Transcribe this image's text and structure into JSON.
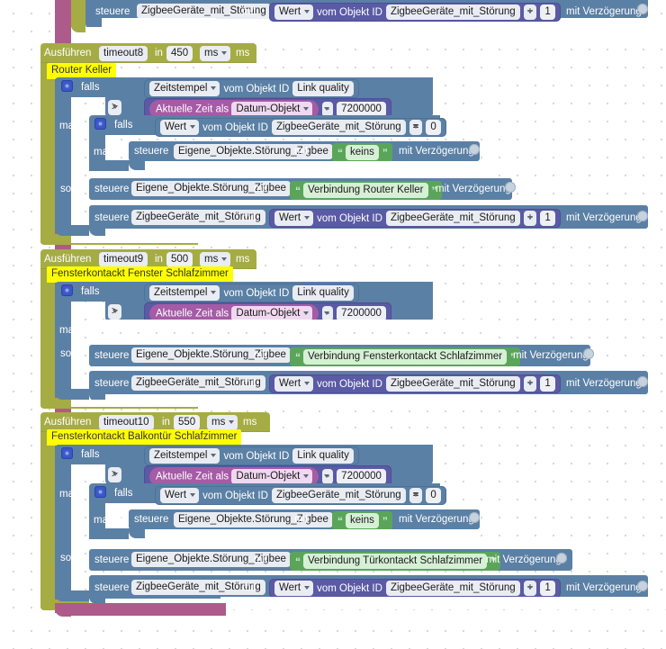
{
  "workspace": {
    "editor": "blockly",
    "grid_color": "#d0d0d0",
    "colors": {
      "wrapper": "#ad5b8a",
      "timeout": "#a5ac43",
      "control": "#5b80a5",
      "math": "#5a5aa5",
      "date": "#a55ba5",
      "text": "#5ba55b",
      "comment": "#ffff00",
      "gear": "#3a56c8"
    }
  },
  "labels": {
    "ausfuehren": "Ausführen",
    "in": "in",
    "ms_unit": "ms",
    "ms_suffix": "ms",
    "falls": "falls",
    "mache": "mache",
    "sonst": "sonst",
    "steuere": "steuere",
    "mit": "mit",
    "vom_objekt_id": "vom Objekt ID",
    "mit_verzoegerung": "mit Verzögerung",
    "wert": "Wert",
    "zeitstempel": "Zeitstempel",
    "aktuelle_zeit_als": "Aktuelle Zeit als",
    "datum_objekt": "Datum-Objekt",
    "link_quality": "Link quality",
    "zigbee_stoerung": "ZigbeeGeräte_mit_Störung",
    "eigene_objekte": "Eigene_Objekte.Störung_Zigbee",
    "keins": "keins",
    "op_gt": ">",
    "op_minus": "-",
    "op_eq": "=",
    "op_plus": "+",
    "ms_7200000": "7200000",
    "zero": "0",
    "one": "1",
    "quote_open": "“",
    "quote_close": "”"
  },
  "top_fragment": {
    "statement": "steuere",
    "target": "ZigbeeGeräte_mit_Störung",
    "mit": "mit",
    "value": {
      "getter": "Wert",
      "of": "vom Objekt ID",
      "object": "ZigbeeGeräte_mit_Störung",
      "operator": "+",
      "operand": "1"
    },
    "delay_label": "mit Verzögerung"
  },
  "sections": [
    {
      "id": "timeout8",
      "timer_name": "timeout8",
      "delay": "450",
      "unit": "ms",
      "comment": "Router Keller",
      "condition": {
        "left_getter": "Zeitstempel",
        "left_of": "vom Objekt ID",
        "left_object": "Link quality",
        "operator": ">",
        "right_date": "Aktuelle Zeit als",
        "right_date_mode": "Datum-Objekt",
        "right_operator": "-",
        "right_value": "7200000"
      },
      "has_inner_if": true,
      "inner_if": {
        "getter": "Wert",
        "of": "vom Objekt ID",
        "object": "ZigbeeGeräte_mit_Störung",
        "operator": "=",
        "value": "0",
        "then_statement": "steuere",
        "then_target": "Eigene_Objekte.Störung_Zigbee",
        "then_mit": "mit",
        "then_text": "keins",
        "then_delay": "mit Verzögerung"
      },
      "else_rows": [
        {
          "statement": "steuere",
          "target": "Eigene_Objekte.Störung_Zigbee",
          "mit": "mit",
          "text": "Verbindung Router Keller",
          "delay": "mit Verzögerung"
        },
        {
          "statement": "steuere",
          "target": "ZigbeeGeräte_mit_Störung",
          "mit": "mit",
          "getter": "Wert",
          "of": "vom Objekt ID",
          "object": "ZigbeeGeräte_mit_Störung",
          "operator": "+",
          "operand": "1",
          "delay": "mit Verzögerung"
        }
      ]
    },
    {
      "id": "timeout9",
      "timer_name": "timeout9",
      "delay": "500",
      "unit": "ms",
      "comment": "Fensterkontackt Fenster Schlafzimmer",
      "condition": {
        "left_getter": "Zeitstempel",
        "left_of": "vom Objekt ID",
        "left_object": "Link quality",
        "operator": ">",
        "right_date": "Aktuelle Zeit als",
        "right_date_mode": "Datum-Objekt",
        "right_operator": "-",
        "right_value": "7200000"
      },
      "has_inner_if": false,
      "else_rows": [
        {
          "statement": "steuere",
          "target": "Eigene_Objekte.Störung_Zigbee",
          "mit": "mit",
          "text": "Verbindung Fensterkontackt Schlafzimmer",
          "delay": "mit Verzögerung"
        },
        {
          "statement": "steuere",
          "target": "ZigbeeGeräte_mit_Störung",
          "mit": "mit",
          "getter": "Wert",
          "of": "vom Objekt ID",
          "object": "ZigbeeGeräte_mit_Störung",
          "operator": "+",
          "operand": "1",
          "delay": "mit Verzögerung"
        }
      ]
    },
    {
      "id": "timeout10",
      "timer_name": "timeout10",
      "delay": "550",
      "unit": "ms",
      "comment": "Fensterkontackt Balkontür Schlafzimmer",
      "condition": {
        "left_getter": "Zeitstempel",
        "left_of": "vom Objekt ID",
        "left_object": "Link quality",
        "operator": ">",
        "right_date": "Aktuelle Zeit als",
        "right_date_mode": "Datum-Objekt",
        "right_operator": "-",
        "right_value": "7200000"
      },
      "has_inner_if": true,
      "inner_if": {
        "getter": "Wert",
        "of": "vom Objekt ID",
        "object": "ZigbeeGeräte_mit_Störung",
        "operator": "=",
        "value": "0",
        "then_statement": "steuere",
        "then_target": "Eigene_Objekte.Störung_Zigbee",
        "then_mit": "mit",
        "then_text": "keins",
        "then_delay": "mit Verzögerung"
      },
      "else_rows": [
        {
          "statement": "steuere",
          "target": "Eigene_Objekte.Störung_Zigbee",
          "mit": "mit",
          "text": "Verbindung Türkontackt Schlafzimmer",
          "delay": "mit Verzögerung"
        },
        {
          "statement": "steuere",
          "target": "ZigbeeGeräte_mit_Störung",
          "mit": "mit",
          "getter": "Wert",
          "of": "vom Objekt ID",
          "object": "ZigbeeGeräte_mit_Störung",
          "operator": "+",
          "operand": "1",
          "delay": "mit Verzögerung"
        }
      ]
    }
  ]
}
